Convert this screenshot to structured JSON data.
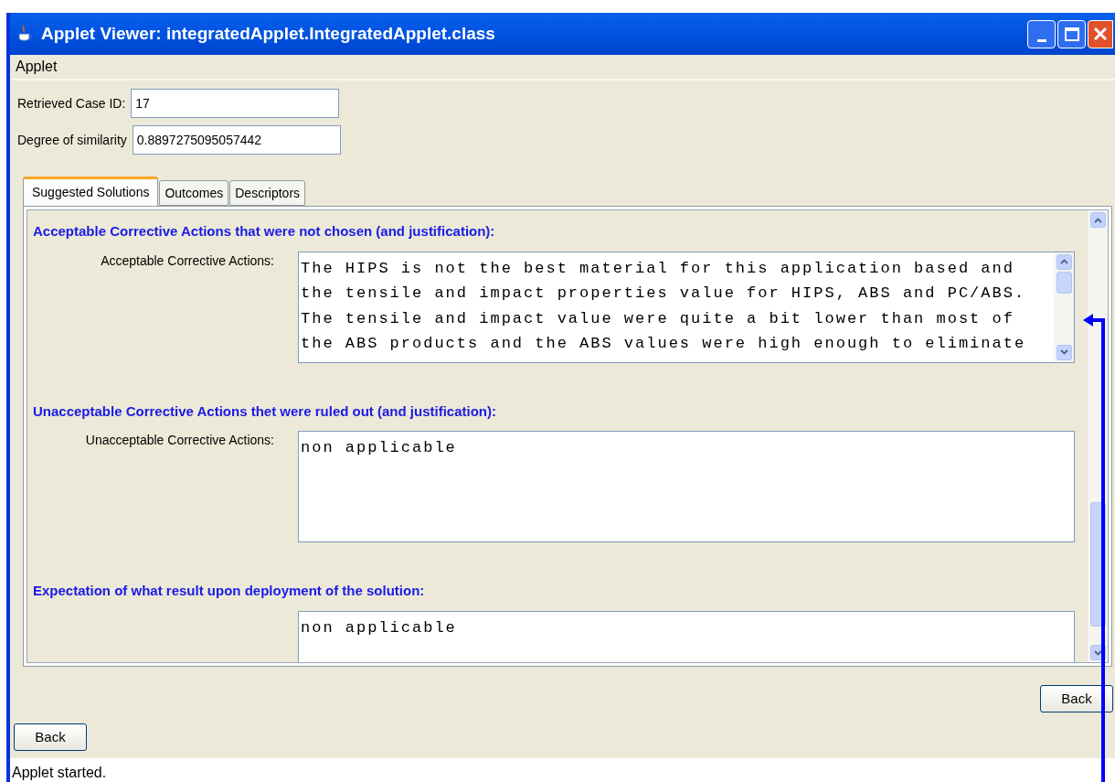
{
  "window": {
    "title": "Applet Viewer: integratedApplet.IntegratedApplet.class"
  },
  "menu": [
    "Applet"
  ],
  "fields": [
    {
      "label": "Retrieved Case ID:",
      "value": "17"
    },
    {
      "label": "Degree of similarity",
      "value": "0.8897275095057442"
    }
  ],
  "tabs": [
    {
      "label": "Suggested Solutions",
      "selected": true
    },
    {
      "label": "Outcomes",
      "selected": false
    },
    {
      "label": "Descriptors",
      "selected": false
    }
  ],
  "sections": [
    {
      "heading": "Acceptable Corrective Actions that were not chosen (and justification):",
      "label": "Acceptable Corrective Actions:",
      "scrollable": true,
      "lines": [
        "The HIPS is not the best material for this application based and",
        "the tensile and impact properties value for HIPS, ABS and PC/ABS.",
        "The tensile and impact value were quite a bit lower than most of",
        "the ABS products and the ABS values were high enough to eliminate"
      ]
    },
    {
      "heading": "Unacceptable Corrective Actions thet were ruled out (and justification):",
      "label": "Unacceptable Corrective Actions:",
      "scrollable": false,
      "lines": [
        "non applicable"
      ]
    },
    {
      "heading": "Expectation of what result upon deployment of the solution:",
      "scrollable": false,
      "lines": [
        "non applicable"
      ]
    }
  ],
  "inner_back": "Back",
  "outer_back": "Back",
  "status": "Applet started."
}
